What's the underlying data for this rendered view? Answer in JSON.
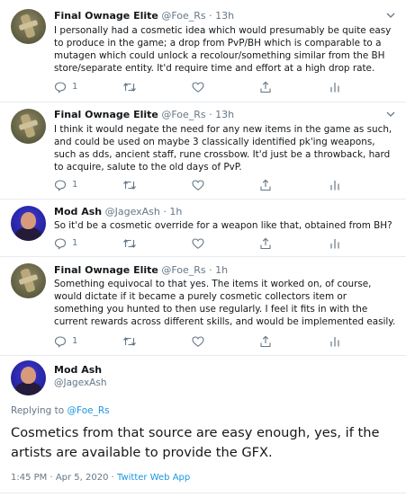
{
  "tweets": [
    {
      "author": "Final Ownage Elite",
      "handle": "@Foe_Rs",
      "time": "· 13h",
      "text": "I personally had a cosmetic idea which would presumably be quite easy to produce in the game; a drop from PvP/BH which is comparable to a mutagen which could unlock a recolour/something similar from the BH store/separate entity. It'd require time and effort at a high drop rate.",
      "reply_count": "1"
    },
    {
      "author": "Final Ownage Elite",
      "handle": "@Foe_Rs",
      "time": "· 13h",
      "text": "I think it would negate the need for any new items in the game as such, and could be used on maybe 3 classically identified pk'ing weapons, such as dds, ancient staff, rune crossbow. It'd just be a throwback, hard to acquire, salute to the old days of PvP.",
      "reply_count": "1"
    },
    {
      "author": "Mod Ash",
      "handle": "@JagexAsh",
      "time": "· 1h",
      "text": "So it'd be a cosmetic override for a weapon like that, obtained from BH?",
      "reply_count": "1"
    },
    {
      "author": "Final Ownage Elite",
      "handle": "@Foe_Rs",
      "time": "· 1h",
      "text": "Something equivocal to that yes. The items it worked on, of course, would dictate if it became a purely cosmetic collectors item or something you hunted to then use regularly. I feel it fits in with the current rewards across different skills, and would be implemented easily.",
      "reply_count": "1"
    }
  ],
  "main": {
    "author": "Mod Ash",
    "handle": "@JagexAsh",
    "replying_prefix": "Replying to ",
    "replying_to": "@Foe_Rs",
    "text": "Cosmetics from that source are easy enough, yes, if the artists are available to provide the GFX.",
    "timestamp": "1:45 PM · Apr 5, 2020 · ",
    "client": "Twitter Web App"
  },
  "colors": {
    "text": "#14171a",
    "muted": "#657786",
    "link": "#1b95e0",
    "border": "#e6ecf0"
  },
  "icons": [
    "reply-icon",
    "retweet-icon",
    "like-icon",
    "share-icon",
    "analytics-icon",
    "chevron-down-icon"
  ]
}
